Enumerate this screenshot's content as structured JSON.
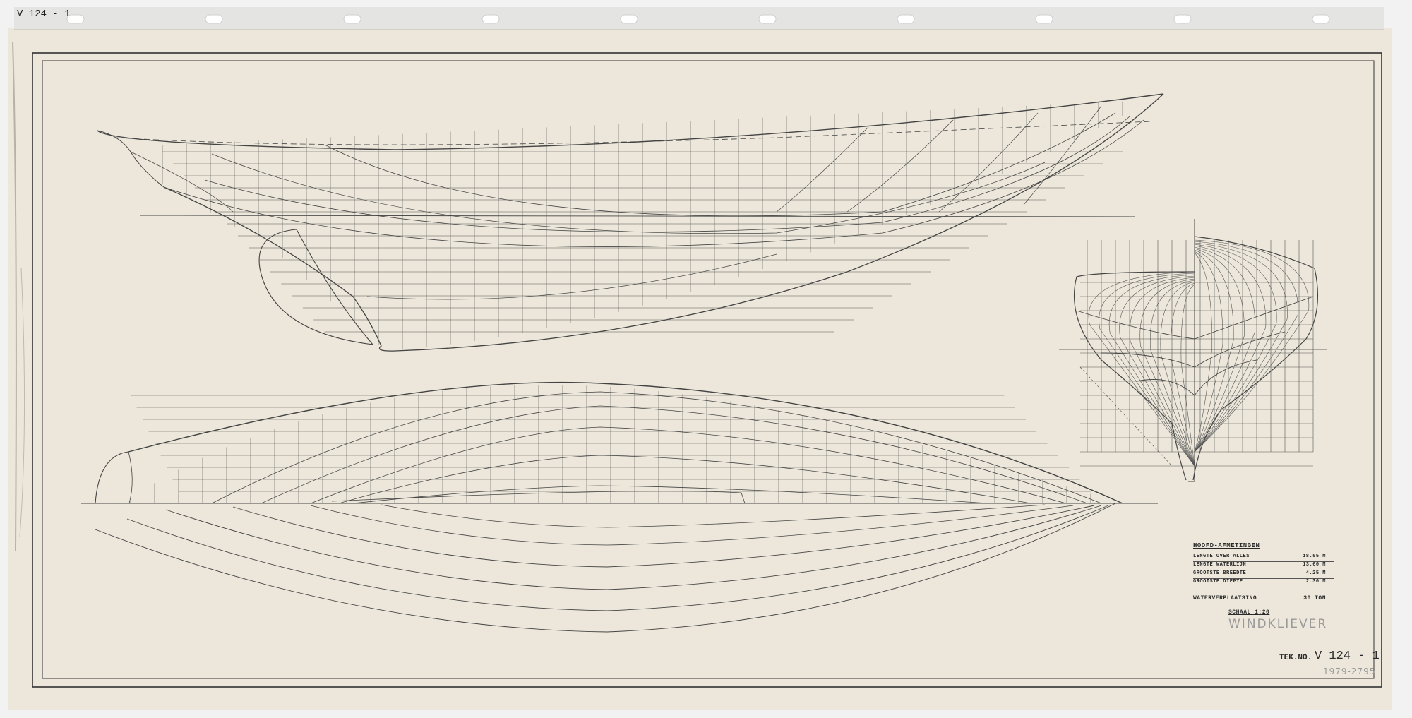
{
  "sheet_ref_top": "V 124 - 1",
  "table": {
    "title": "HOOFD-AFMETINGEN",
    "rows": [
      {
        "label": "LENGTE OVER ALLES",
        "value": "18.55 M"
      },
      {
        "label": "LENGTE WATERLIJN",
        "value": "13.60 M"
      },
      {
        "label": "GROOTSTE BREEDTE",
        "value": "4.25 M"
      },
      {
        "label": "GROOTSTE DIEPTE",
        "value": "2.30 M"
      }
    ],
    "displacement_label": "WATERVERPLAATSING",
    "displacement_value": "30 TON",
    "scale": "SCHAAL 1:20"
  },
  "pencil_name": "WINDKLIEVER",
  "drawing_number_label": "TEK.NO.",
  "drawing_number": "V 124 - 1",
  "archive_number": "1979-2795",
  "colors": {
    "paper": "#ece7da",
    "ink": "#3a3a3a",
    "pencil": "#9a9a9a"
  }
}
